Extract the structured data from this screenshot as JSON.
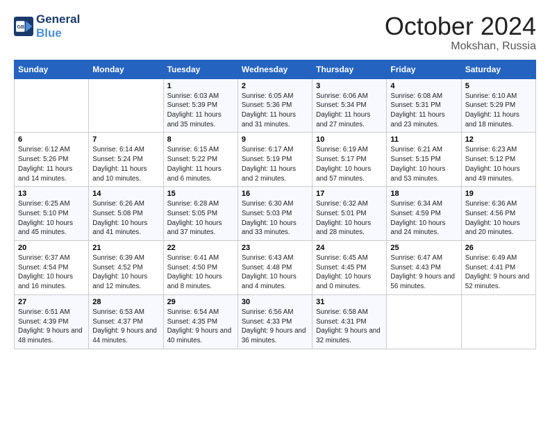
{
  "header": {
    "logo_line1": "General",
    "logo_line2": "Blue",
    "month": "October 2024",
    "location": "Mokshan, Russia"
  },
  "weekdays": [
    "Sunday",
    "Monday",
    "Tuesday",
    "Wednesday",
    "Thursday",
    "Friday",
    "Saturday"
  ],
  "weeks": [
    [
      {
        "day": "",
        "info": ""
      },
      {
        "day": "",
        "info": ""
      },
      {
        "day": "1",
        "info": "Sunrise: 6:03 AM\nSunset: 5:39 PM\nDaylight: 11 hours and 35 minutes."
      },
      {
        "day": "2",
        "info": "Sunrise: 6:05 AM\nSunset: 5:36 PM\nDaylight: 11 hours and 31 minutes."
      },
      {
        "day": "3",
        "info": "Sunrise: 6:06 AM\nSunset: 5:34 PM\nDaylight: 11 hours and 27 minutes."
      },
      {
        "day": "4",
        "info": "Sunrise: 6:08 AM\nSunset: 5:31 PM\nDaylight: 11 hours and 23 minutes."
      },
      {
        "day": "5",
        "info": "Sunrise: 6:10 AM\nSunset: 5:29 PM\nDaylight: 11 hours and 18 minutes."
      }
    ],
    [
      {
        "day": "6",
        "info": "Sunrise: 6:12 AM\nSunset: 5:26 PM\nDaylight: 11 hours and 14 minutes."
      },
      {
        "day": "7",
        "info": "Sunrise: 6:14 AM\nSunset: 5:24 PM\nDaylight: 11 hours and 10 minutes."
      },
      {
        "day": "8",
        "info": "Sunrise: 6:15 AM\nSunset: 5:22 PM\nDaylight: 11 hours and 6 minutes."
      },
      {
        "day": "9",
        "info": "Sunrise: 6:17 AM\nSunset: 5:19 PM\nDaylight: 11 hours and 2 minutes."
      },
      {
        "day": "10",
        "info": "Sunrise: 6:19 AM\nSunset: 5:17 PM\nDaylight: 10 hours and 57 minutes."
      },
      {
        "day": "11",
        "info": "Sunrise: 6:21 AM\nSunset: 5:15 PM\nDaylight: 10 hours and 53 minutes."
      },
      {
        "day": "12",
        "info": "Sunrise: 6:23 AM\nSunset: 5:12 PM\nDaylight: 10 hours and 49 minutes."
      }
    ],
    [
      {
        "day": "13",
        "info": "Sunrise: 6:25 AM\nSunset: 5:10 PM\nDaylight: 10 hours and 45 minutes."
      },
      {
        "day": "14",
        "info": "Sunrise: 6:26 AM\nSunset: 5:08 PM\nDaylight: 10 hours and 41 minutes."
      },
      {
        "day": "15",
        "info": "Sunrise: 6:28 AM\nSunset: 5:05 PM\nDaylight: 10 hours and 37 minutes."
      },
      {
        "day": "16",
        "info": "Sunrise: 6:30 AM\nSunset: 5:03 PM\nDaylight: 10 hours and 33 minutes."
      },
      {
        "day": "17",
        "info": "Sunrise: 6:32 AM\nSunset: 5:01 PM\nDaylight: 10 hours and 28 minutes."
      },
      {
        "day": "18",
        "info": "Sunrise: 6:34 AM\nSunset: 4:59 PM\nDaylight: 10 hours and 24 minutes."
      },
      {
        "day": "19",
        "info": "Sunrise: 6:36 AM\nSunset: 4:56 PM\nDaylight: 10 hours and 20 minutes."
      }
    ],
    [
      {
        "day": "20",
        "info": "Sunrise: 6:37 AM\nSunset: 4:54 PM\nDaylight: 10 hours and 16 minutes."
      },
      {
        "day": "21",
        "info": "Sunrise: 6:39 AM\nSunset: 4:52 PM\nDaylight: 10 hours and 12 minutes."
      },
      {
        "day": "22",
        "info": "Sunrise: 6:41 AM\nSunset: 4:50 PM\nDaylight: 10 hours and 8 minutes."
      },
      {
        "day": "23",
        "info": "Sunrise: 6:43 AM\nSunset: 4:48 PM\nDaylight: 10 hours and 4 minutes."
      },
      {
        "day": "24",
        "info": "Sunrise: 6:45 AM\nSunset: 4:45 PM\nDaylight: 10 hours and 0 minutes."
      },
      {
        "day": "25",
        "info": "Sunrise: 6:47 AM\nSunset: 4:43 PM\nDaylight: 9 hours and 56 minutes."
      },
      {
        "day": "26",
        "info": "Sunrise: 6:49 AM\nSunset: 4:41 PM\nDaylight: 9 hours and 52 minutes."
      }
    ],
    [
      {
        "day": "27",
        "info": "Sunrise: 6:51 AM\nSunset: 4:39 PM\nDaylight: 9 hours and 48 minutes."
      },
      {
        "day": "28",
        "info": "Sunrise: 6:53 AM\nSunset: 4:37 PM\nDaylight: 9 hours and 44 minutes."
      },
      {
        "day": "29",
        "info": "Sunrise: 6:54 AM\nSunset: 4:35 PM\nDaylight: 9 hours and 40 minutes."
      },
      {
        "day": "30",
        "info": "Sunrise: 6:56 AM\nSunset: 4:33 PM\nDaylight: 9 hours and 36 minutes."
      },
      {
        "day": "31",
        "info": "Sunrise: 6:58 AM\nSunset: 4:31 PM\nDaylight: 9 hours and 32 minutes."
      },
      {
        "day": "",
        "info": ""
      },
      {
        "day": "",
        "info": ""
      }
    ]
  ]
}
